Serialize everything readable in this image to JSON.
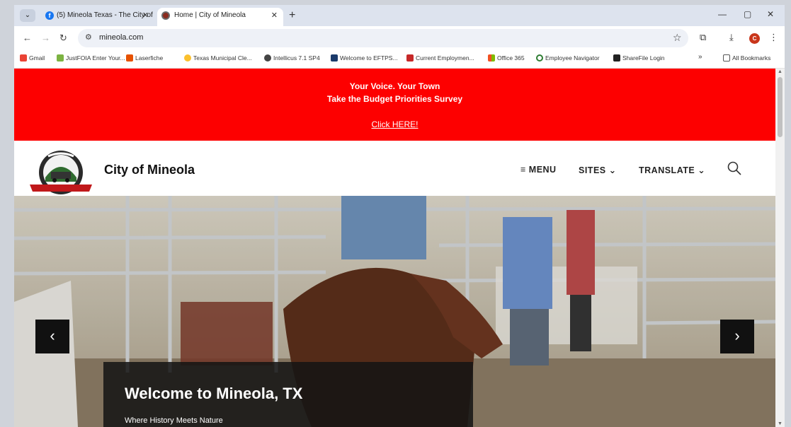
{
  "browser": {
    "tabs": [
      {
        "title": "(5) Mineola Texas - The City of",
        "favicon": "facebook-icon"
      },
      {
        "title": "Home | City of Mineola",
        "favicon": "city-seal-icon"
      }
    ],
    "url": "mineola.com",
    "profile_initial": "C",
    "bookmarks": [
      "Gmail",
      "JustFOIA Enter Your...",
      "Laserfiche",
      "Texas Municipal Cle...",
      "Intellicus 7.1 SP4",
      "Welcome to EFTPS...",
      "Current Employmen...",
      "Office 365",
      "Employee Navigator",
      "ShareFile Login"
    ],
    "all_bookmarks": "All Bookmarks"
  },
  "banner": {
    "line1": "Your Voice. Your Town",
    "line2": "Take the Budget Priorities Survey",
    "link": "Click HERE!",
    "color": "#fd0000"
  },
  "header": {
    "site_name": "City of Mineola",
    "nav": {
      "menu": "MENU",
      "sites": "SITES",
      "translate": "TRANSLATE"
    }
  },
  "hero": {
    "title": "Welcome to Mineola, TX",
    "subtitle": "Where History Meets Nature"
  }
}
